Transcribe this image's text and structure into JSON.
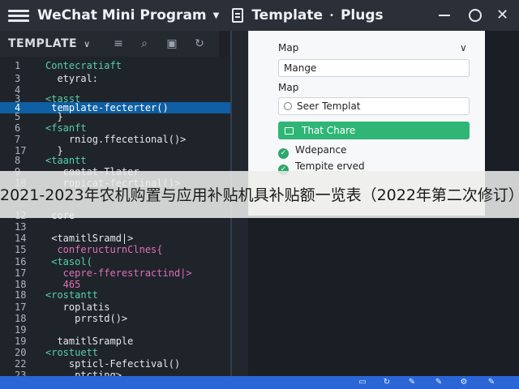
{
  "titlebar": {
    "app_name": "WeChat Mini Program",
    "caret": "▼",
    "template_label": "Template",
    "dot": "•",
    "plugs_label": "Plugs",
    "close_glyph": "✕"
  },
  "explorer": {
    "title": "TEMPLATE",
    "chevron": "∨",
    "icons": [
      "menu-lines-icon",
      "search-icon",
      "package-icon",
      "refresh-icon"
    ]
  },
  "code_lines": [
    {
      "num": "1",
      "text": "Contecratiaft",
      "cls": "c-tag"
    },
    {
      "num": "3",
      "text": "  etyral:",
      "cls": "c-fn"
    },
    {
      "num": "4",
      "text": "",
      "cls": ""
    },
    {
      "num": "3",
      "text": "<tasst",
      "cls": "c-tag"
    },
    {
      "num": "4",
      "text": " template-fecterter()",
      "cls": "c-fn",
      "hl": true
    },
    {
      "num": "5",
      "text": "  }",
      "cls": "c-fn"
    },
    {
      "num": "6",
      "text": "<fsanft",
      "cls": "c-tag"
    },
    {
      "num": "7",
      "text": "    rniog.ffecetional()>",
      "cls": "c-fn"
    },
    {
      "num": "17",
      "text": "  }",
      "cls": "c-fn"
    },
    {
      "num": "8",
      "text": "<taantt",
      "cls": "c-tag"
    },
    {
      "num": "9",
      "text": "   cootat-Tlater",
      "cls": "c-fn"
    },
    {
      "num": "10",
      "text": "   ropicat-fecrtinal()>",
      "cls": "c-fn"
    },
    {
      "num": "11",
      "text": "    fire",
      "cls": "c-pink"
    },
    {
      "num": "12",
      "text": " core",
      "cls": "c-fn"
    },
    {
      "num": "13",
      "text": "",
      "cls": ""
    },
    {
      "num": "14",
      "text": " <tamitlSramd|>",
      "cls": "c-fn"
    },
    {
      "num": "15",
      "text": "  conferucturnClnes{",
      "cls": "c-pink"
    },
    {
      "num": "16",
      "text": " <tasol(",
      "cls": "c-tag"
    },
    {
      "num": "17",
      "text": "   cepre-fferestractind|>",
      "cls": "c-pink"
    },
    {
      "num": "18",
      "text": "   465",
      "cls": "c-pink"
    },
    {
      "num": "18",
      "text": "<rostantt",
      "cls": "c-tag"
    },
    {
      "num": "17",
      "text": "   roplatis",
      "cls": "c-fn"
    },
    {
      "num": "18",
      "text": "     prrstd()>",
      "cls": "c-fn"
    },
    {
      "num": "19",
      "text": "",
      "cls": ""
    },
    {
      "num": "19",
      "text": "  tamitlSrample",
      "cls": "c-fn"
    },
    {
      "num": "20",
      "text": "<rostuett",
      "cls": "c-tag"
    },
    {
      "num": "22",
      "text": "    spticl-Fefectival()",
      "cls": "c-fn"
    },
    {
      "num": "23",
      "text": "     ptcting>",
      "cls": "c-fn"
    }
  ],
  "preview": {
    "label_map_1": "Map",
    "chevron": "∨",
    "field_mange": "Mange",
    "label_map_2": "Map",
    "radio_text": "Seer Templat",
    "button_text": "That Chare",
    "check_1": "Wdepance",
    "check_2": "Tempite erved",
    "check_glyph": "✓"
  },
  "watermark": {
    "text": "2021-2023年农机购置与应用补贴机具补贴额一览表（2022年第二次修订）"
  },
  "statusbar": {
    "icons": [
      "terminal-icon",
      "sync-icon",
      "edit-icon",
      "pencil-icon",
      "settings-icon",
      "edit-alt-icon"
    ]
  },
  "colors": {
    "highlight": "#0e5fa3",
    "button": "#2fb676",
    "status": "#2a66d6"
  }
}
